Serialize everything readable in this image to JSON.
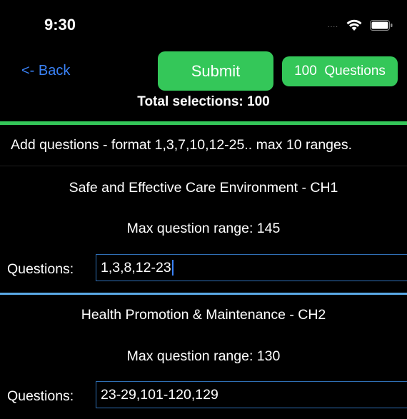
{
  "status_bar": {
    "time": "9:30",
    "signal": "....",
    "wifi_icon": "wifi-icon",
    "battery_icon": "battery-icon"
  },
  "nav": {
    "back_label": "<- Back",
    "submit_label": "Submit",
    "count_label": "100  Questions",
    "total_selections": "Total selections: 100"
  },
  "instructions": "Add questions - format 1,3,7,10,12-25.. max 10 ranges.",
  "sections": [
    {
      "title": "Safe and Effective Care Environment - CH1",
      "max_range": "Max question range: 145",
      "questions_label": "Questions:",
      "questions_value": "1,3,8,12-23"
    },
    {
      "title": "Health Promotion & Maintenance - CH2",
      "max_range": "Max question range: 130",
      "questions_label": "Questions:",
      "questions_value": "23-29,101-120,129"
    }
  ],
  "colors": {
    "background": "#000000",
    "accent_green": "#34c759",
    "link_blue": "#3a82f7",
    "input_border": "#2f6fb5",
    "section_divider": "#5aa9e6"
  }
}
